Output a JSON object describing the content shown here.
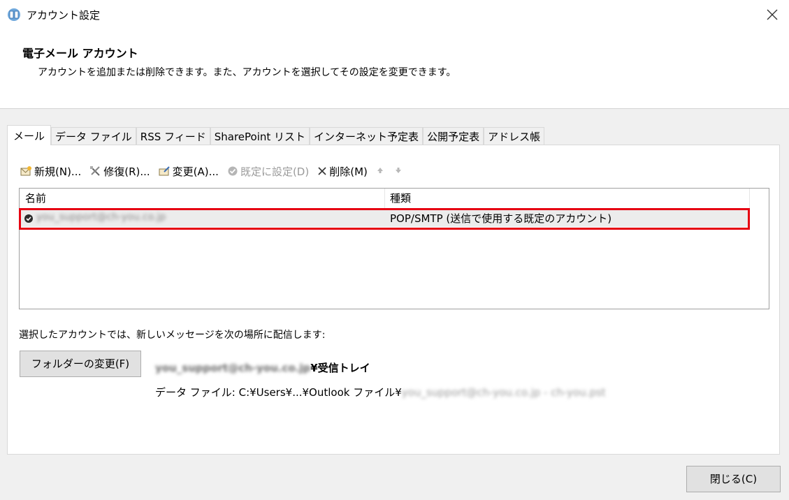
{
  "window": {
    "title": "アカウント設定",
    "close_label": "×"
  },
  "header": {
    "title": "電子メール アカウント",
    "description": "アカウントを追加または削除できます。また、アカウントを選択してその設定を変更できます。"
  },
  "tabs": [
    {
      "label": "メール",
      "active": true
    },
    {
      "label": "データ ファイル"
    },
    {
      "label": "RSS フィード"
    },
    {
      "label": "SharePoint リスト"
    },
    {
      "label": "インターネット予定表"
    },
    {
      "label": "公開予定表"
    },
    {
      "label": "アドレス帳"
    }
  ],
  "toolbar": {
    "new_label": "新規(N)...",
    "repair_label": "修復(R)...",
    "change_label": "変更(A)...",
    "set_default_label": "既定に設定(D)",
    "delete_label": "削除(M)"
  },
  "list": {
    "columns": [
      "名前",
      "種類"
    ],
    "rows": [
      {
        "name": "you_support@ch-you.co.jp",
        "type": "POP/SMTP (送信で使用する既定のアカウント)"
      }
    ]
  },
  "delivery": {
    "label": "選択したアカウントでは、新しいメッセージを次の場所に配信します:",
    "folder_button": "フォルダーの変更(F)",
    "account": "you_support@ch-you.co.jp",
    "folder": "¥受信トレイ",
    "datafile_prefix": "データ ファイル: C:¥Users¥...¥Outlook ファイル¥",
    "datafile_name": "you_support@ch-you.co.jp - ch-you.pst"
  },
  "footer": {
    "close_button": "閉じる(C)"
  },
  "colors": {
    "highlight": "#e60012",
    "panel_bg": "#f0f0f0"
  }
}
